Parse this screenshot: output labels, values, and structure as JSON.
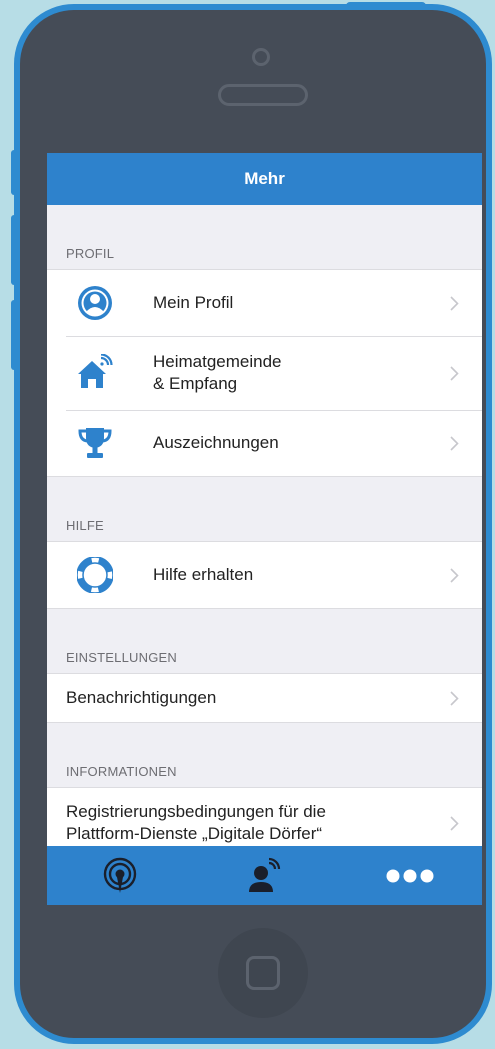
{
  "navbar": {
    "title": "Mehr"
  },
  "sections": {
    "profil": {
      "header": "PROFIL",
      "items": [
        {
          "label": "Mein Profil",
          "icon": "user-circle-icon"
        },
        {
          "label_line1": "Heimatgemeinde",
          "label_line2": "& Empfang",
          "icon": "home-signal-icon"
        },
        {
          "label": "Auszeichnungen",
          "icon": "trophy-icon"
        }
      ]
    },
    "hilfe": {
      "header": "HILFE",
      "items": [
        {
          "label": "Hilfe erhalten",
          "icon": "lifebuoy-icon"
        }
      ]
    },
    "einstellungen": {
      "header": "EINSTELLUNGEN",
      "items": [
        {
          "label": "Benachrichtigungen"
        }
      ]
    },
    "informationen": {
      "header": "INFORMATIONEN",
      "items": [
        {
          "label_line1": "Registrierungsbedingungen für die",
          "label_line2": "Plattform-Dienste „Digitale Dörfer“"
        }
      ]
    }
  },
  "tabbar": {
    "tabs": [
      {
        "icon": "broadcast-icon"
      },
      {
        "icon": "person-signal-icon"
      },
      {
        "icon": "more-dots-icon"
      }
    ]
  },
  "colors": {
    "accent": "#2e82cc",
    "phone_frame": "#2e8bd0",
    "phone_body": "#454c57",
    "background": "#b7dde6"
  }
}
